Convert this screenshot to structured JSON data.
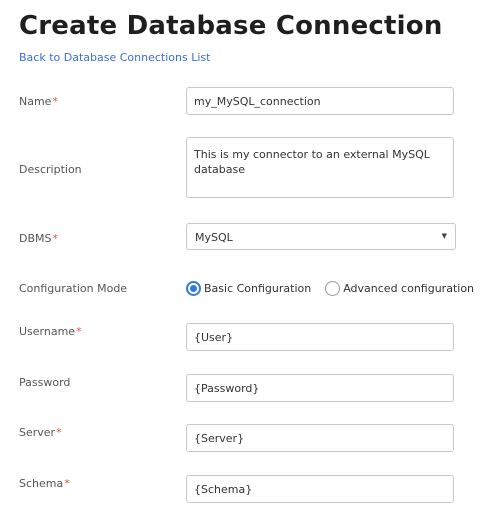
{
  "page": {
    "title": "Create Database Connection",
    "back_link": "Back to Database Connections List"
  },
  "form": {
    "name": {
      "label": "Name",
      "required": "*",
      "value": "my_MySQL_connection"
    },
    "description": {
      "label": "Description",
      "value": "This is my connector to an external MySQL database"
    },
    "dbms": {
      "label": "DBMS",
      "required": "*",
      "selected": "MySQL",
      "caret": "▼"
    },
    "config_mode": {
      "label": "Configuration Mode",
      "options": [
        {
          "label": "Basic Configuration",
          "checked": true
        },
        {
          "label": "Advanced configuration",
          "checked": false
        }
      ]
    },
    "username": {
      "label": "Username",
      "required": "*",
      "value": "{User}"
    },
    "password": {
      "label": "Password",
      "value": "{Password}"
    },
    "server": {
      "label": "Server",
      "required": "*",
      "value": "{Server}"
    },
    "schema": {
      "label": "Schema",
      "required": "*",
      "value": "{Schema}"
    }
  },
  "colors": {
    "link": "#3a6fd6",
    "required": "#d9534f",
    "radio_accent": "#2f7be0"
  }
}
